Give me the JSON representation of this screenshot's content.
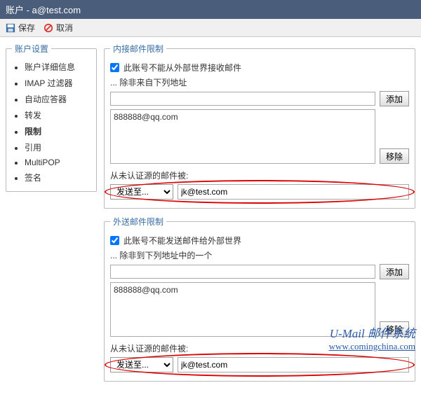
{
  "titlebar": "账户 - a@test.com",
  "toolbar": {
    "save": "保存",
    "cancel": "取消"
  },
  "sidebar": {
    "legend": "账户设置",
    "items": [
      "账户详细信息",
      "IMAP 过滤器",
      "自动应答器",
      "转发",
      "限制",
      "引用",
      "MultiPOP",
      "签名"
    ],
    "active": "限制"
  },
  "inbound": {
    "legend": "内接邮件限制",
    "checkbox_label": "此账号不能从外部世界接收邮件",
    "exception_label": "... 除非来自下列地址",
    "add": "添加",
    "list": [
      "888888@qq.com"
    ],
    "remove": "移除",
    "unauth_label": "从未认证源的邮件被:",
    "action": "发送至...",
    "dest": "jk@test.com"
  },
  "outbound": {
    "legend": "外送邮件限制",
    "checkbox_label": "此账号不能发送邮件给外部世界",
    "exception_label": "... 除非到下列地址中的一个",
    "add": "添加",
    "list": [
      "888888@qq.com"
    ],
    "remove": "移除",
    "unauth_label": "从未认证源的邮件被:",
    "action": "发送至...",
    "dest": "jk@test.com"
  },
  "watermark": {
    "line1": "U-Mail 邮件系统",
    "line2": "www.comingchina.com"
  }
}
